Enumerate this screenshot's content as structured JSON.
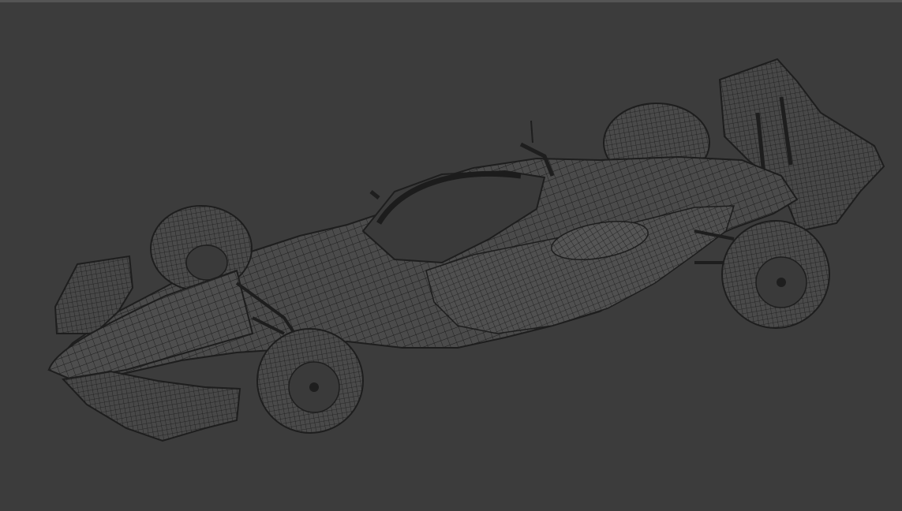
{
  "viewport": {
    "background_color": "#3c3c3c",
    "wire_color": "#1e1e1e",
    "body_color": "#4a4a4a",
    "subject": "indycar-wireframe-model"
  }
}
